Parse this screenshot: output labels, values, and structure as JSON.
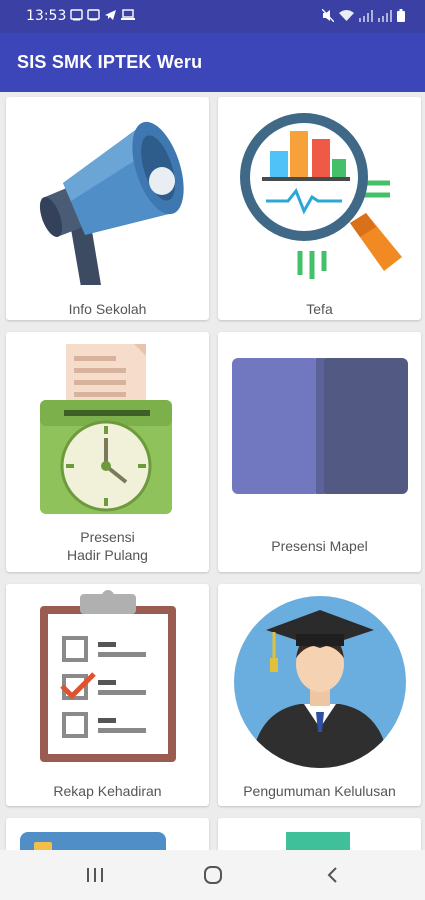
{
  "status_bar": {
    "time": "13:53",
    "left_icons": [
      "image-icon",
      "image-icon",
      "telegram-icon",
      "laptop-icon"
    ],
    "right_icons": [
      "mute-icon",
      "wifi-icon",
      "signal-icon",
      "signal-icon",
      "battery-icon"
    ]
  },
  "app_bar": {
    "title": "SIS SMK IPTEK Weru",
    "background": "#3c46b8"
  },
  "menu": {
    "items": [
      {
        "label": "Info Sekolah",
        "icon": "megaphone-icon"
      },
      {
        "label": "Tefa",
        "icon": "magnifier-chart-icon"
      },
      {
        "label_line1": "Presensi",
        "label_line2": "Hadir Pulang",
        "icon": "time-clock-icon"
      },
      {
        "label": "Presensi Mapel",
        "icon": "book-icon"
      },
      {
        "label": "Rekap Kehadiran",
        "icon": "clipboard-checklist-icon"
      },
      {
        "label": "Pengumuman Kelulusan",
        "icon": "graduate-icon"
      },
      {
        "label": "",
        "icon": "card-icon"
      },
      {
        "label": "",
        "icon": "money-icon"
      }
    ]
  },
  "nav_bar": {
    "buttons": [
      "recents-icon",
      "home-icon",
      "back-icon"
    ]
  }
}
